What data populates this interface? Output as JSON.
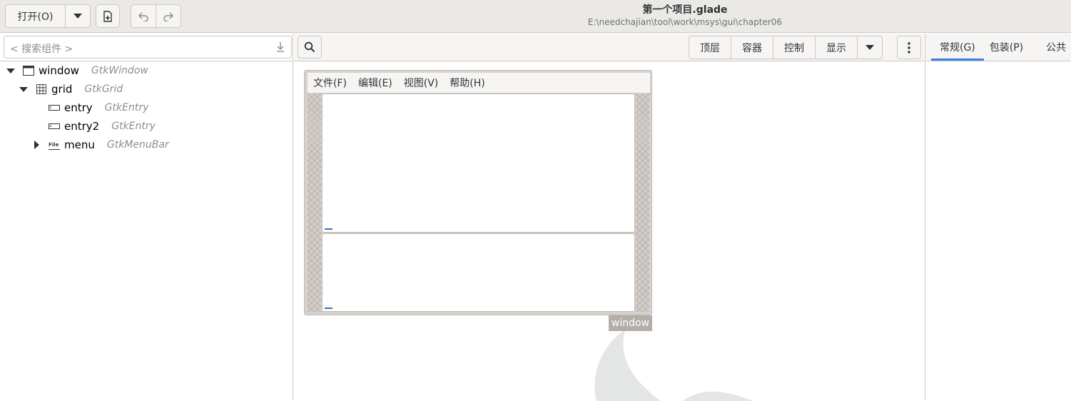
{
  "header": {
    "open_label": "打开(O)",
    "title": "第一个项目.glade",
    "path": "E:\\needchajian\\tool\\work\\msys\\gui\\chapter06"
  },
  "left": {
    "search_placeholder": "< 搜索组件 >",
    "tree": [
      {
        "name": "window",
        "class": "GtkWindow"
      },
      {
        "name": "grid",
        "class": "GtkGrid"
      },
      {
        "name": "entry",
        "class": "GtkEntry"
      },
      {
        "name": "entry2",
        "class": "GtkEntry"
      },
      {
        "name": "menu",
        "class": "GtkMenuBar"
      }
    ],
    "file_icon_text": "File"
  },
  "palette": {
    "buttons": [
      "顶层",
      "容器",
      "控制",
      "显示"
    ]
  },
  "design": {
    "menus": [
      "文件(F)",
      "编辑(E)",
      "视图(V)",
      "帮助(H)"
    ],
    "window_label": "window"
  },
  "right": {
    "tabs": [
      "常规(G)",
      "包装(P)",
      "公共"
    ]
  }
}
